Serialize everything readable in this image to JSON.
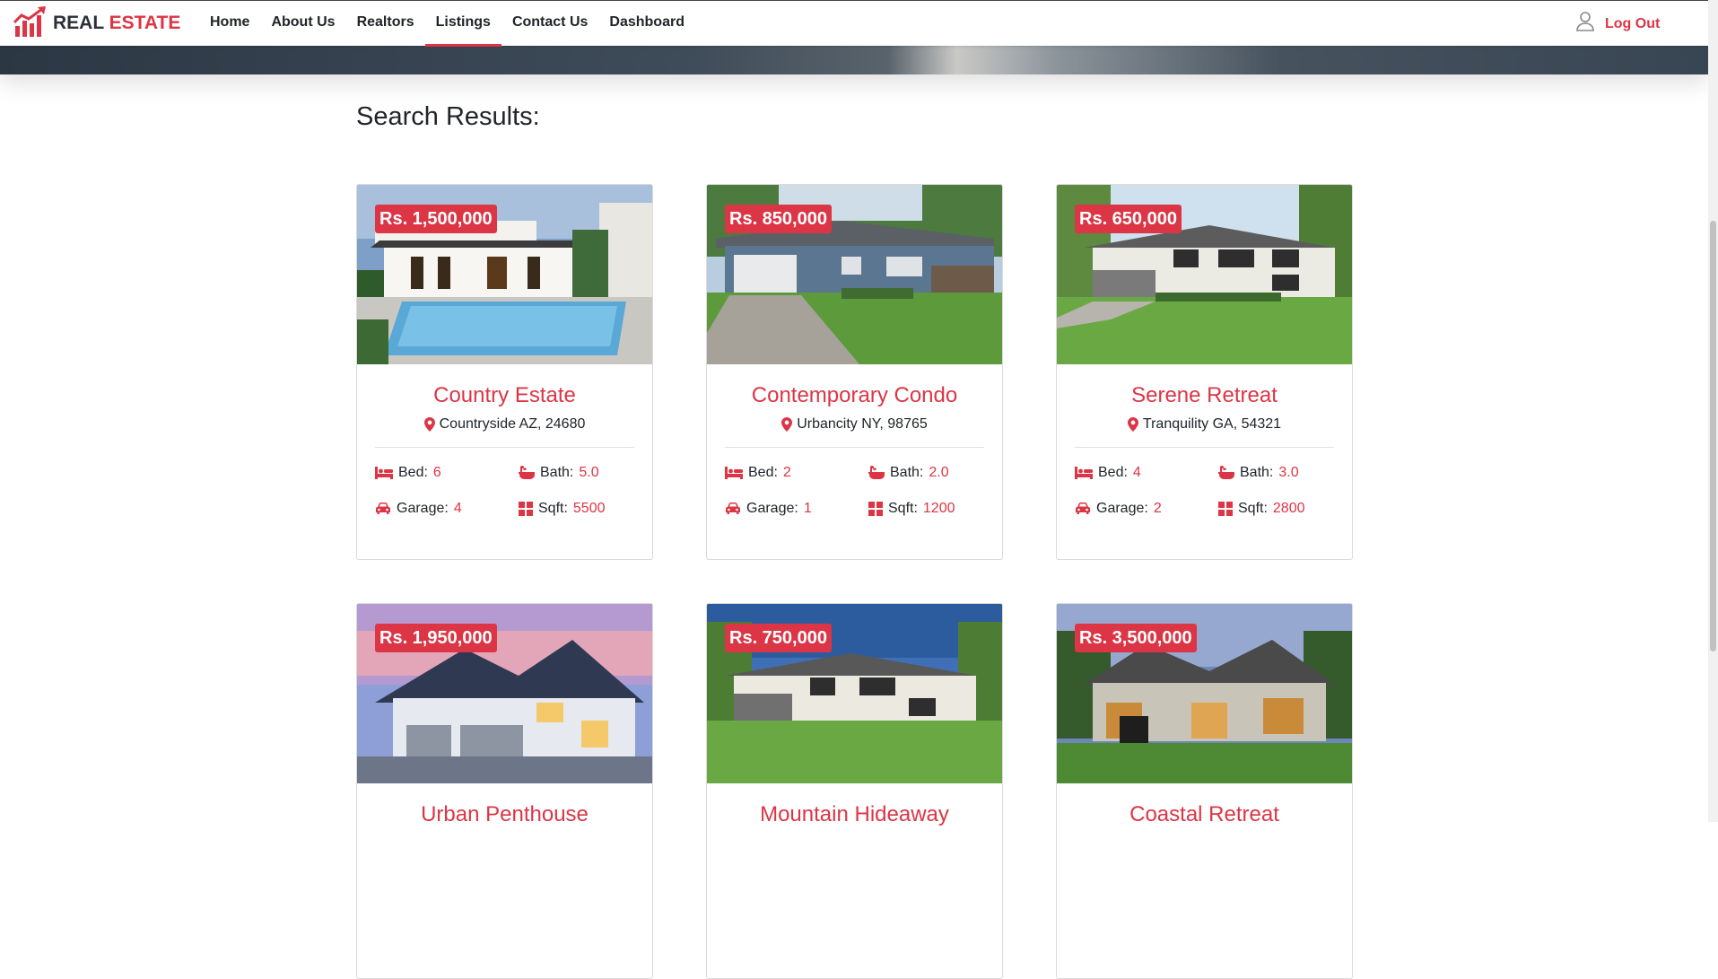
{
  "brand": {
    "part1": "REAL",
    "part2": "ESTATE"
  },
  "nav": [
    {
      "label": "Home"
    },
    {
      "label": "About Us"
    },
    {
      "label": "Realtors"
    },
    {
      "label": "Listings",
      "active": true
    },
    {
      "label": "Contact Us"
    },
    {
      "label": "Dashboard"
    }
  ],
  "user": {
    "logout_label": "Log Out"
  },
  "page": {
    "title": "Search Results:"
  },
  "listings": [
    {
      "price": "Rs. 1,500,000",
      "title": "Country Estate",
      "location": "Countryside AZ, 24680",
      "bed_label": "Bed:",
      "bed": "6",
      "bath_label": "Bath:",
      "bath": "5.0",
      "garage_label": "Garage:",
      "garage": "4",
      "sqft_label": "Sqft:",
      "sqft": "5500"
    },
    {
      "price": "Rs. 850,000",
      "title": "Contemporary Condo",
      "location": "Urbancity NY, 98765",
      "bed_label": "Bed:",
      "bed": "2",
      "bath_label": "Bath:",
      "bath": "2.0",
      "garage_label": "Garage:",
      "garage": "1",
      "sqft_label": "Sqft:",
      "sqft": "1200"
    },
    {
      "price": "Rs. 650,000",
      "title": "Serene Retreat",
      "location": "Tranquility GA, 54321",
      "bed_label": "Bed:",
      "bed": "4",
      "bath_label": "Bath:",
      "bath": "3.0",
      "garage_label": "Garage:",
      "garage": "2",
      "sqft_label": "Sqft:",
      "sqft": "2800"
    },
    {
      "price": "Rs. 1,950,000",
      "title": "Urban Penthouse"
    },
    {
      "price": "Rs. 750,000",
      "title": "Mountain Hideaway"
    },
    {
      "price": "Rs. 3,500,000",
      "title": "Coastal Retreat"
    }
  ],
  "colors": {
    "accent": "#dc3545",
    "text": "#212529"
  },
  "icons": [
    "logo-chart-icon",
    "user-icon",
    "map-marker-icon",
    "bed-icon",
    "bath-icon",
    "car-icon",
    "area-icon"
  ]
}
